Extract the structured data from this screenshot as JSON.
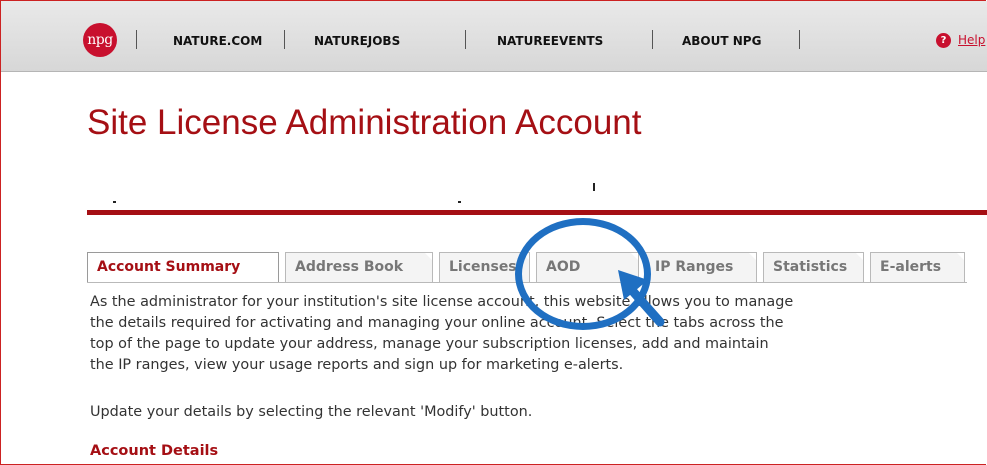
{
  "topbar": {
    "logo_text": "npg",
    "nav": [
      "NATURE.COM",
      "NATUREJOBS",
      "NATUREEVENTS",
      "ABOUT NPG"
    ],
    "help_icon": "?",
    "help_label": "Help"
  },
  "page": {
    "title": "Site License Administration Account"
  },
  "tabs": [
    {
      "label": "Account Summary",
      "active": true
    },
    {
      "label": "Address Book",
      "active": false
    },
    {
      "label": "Licenses",
      "active": false
    },
    {
      "label": "AOD",
      "active": false
    },
    {
      "label": "IP Ranges",
      "active": false
    },
    {
      "label": "Statistics",
      "active": false
    },
    {
      "label": "E-alerts",
      "active": false
    }
  ],
  "content": {
    "intro_lines": [
      "As the administrator for your institution's site license account, this website allows you to manage",
      "the details required for activating and managing your online account. Select the tabs across the",
      "top of the page to update your address, manage your subscription licenses, add and maintain",
      "the IP ranges, view your usage reports and sign up for marketing e-alerts."
    ],
    "update_note": "Update your details by selecting the relevant 'Modify' button.",
    "section_heading": "Account Details"
  },
  "colors": {
    "brand_red": "#a50f14",
    "annotation_blue": "#1f6fc2"
  }
}
